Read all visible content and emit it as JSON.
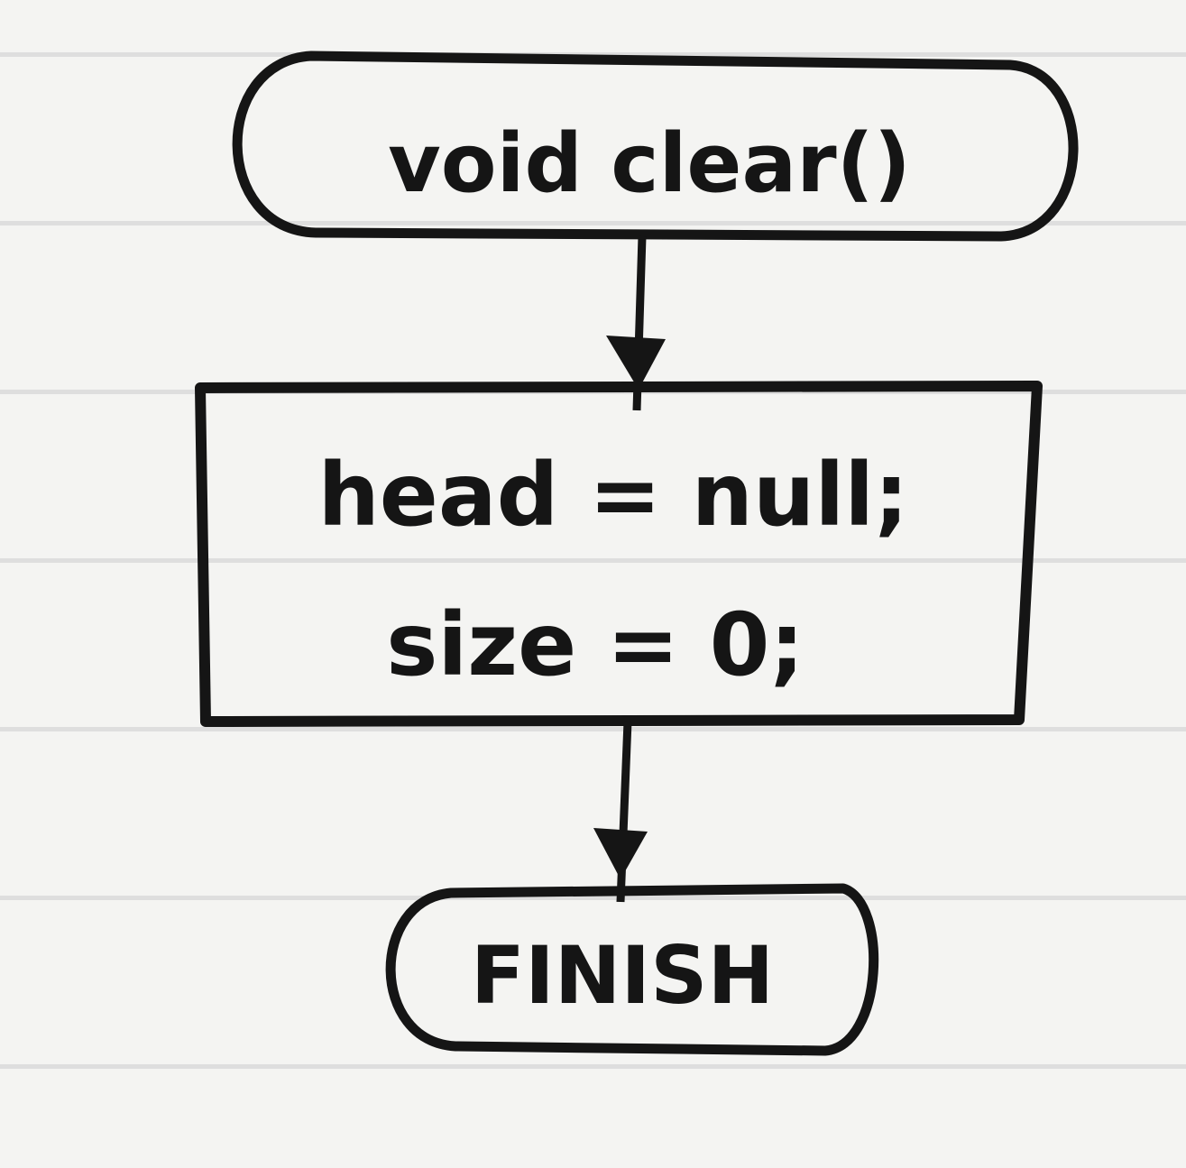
{
  "flowchart": {
    "start_node": {
      "shape": "terminal",
      "label": "void clear()"
    },
    "process_node": {
      "shape": "process",
      "lines": [
        "head = null;",
        "size = 0;"
      ]
    },
    "end_node": {
      "shape": "terminal",
      "label": "FINISH"
    },
    "edges": [
      {
        "from": "start_node",
        "to": "process_node"
      },
      {
        "from": "process_node",
        "to": "end_node"
      }
    ]
  },
  "colors": {
    "ink": "#151515",
    "paper": "#f4f4f2",
    "ruled_line": "#dedede"
  }
}
